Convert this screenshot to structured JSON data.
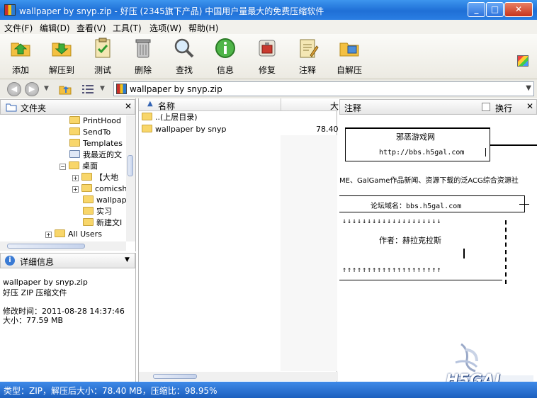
{
  "window": {
    "title": "wallpaper  by snyp.zip - 好压 (2345旗下产品) 中国用户量最大的免费压缩软件"
  },
  "menu": [
    "文件(F)",
    "编辑(D)",
    "查看(V)",
    "工具(T)",
    "选项(W)",
    "帮助(H)"
  ],
  "toolbar": [
    {
      "label": "添加",
      "icon": "add-icon"
    },
    {
      "label": "解压到",
      "icon": "extract-icon"
    },
    {
      "label": "测试",
      "icon": "test-icon"
    },
    {
      "label": "删除",
      "icon": "delete-icon"
    },
    {
      "label": "查找",
      "icon": "find-icon"
    },
    {
      "label": "信息",
      "icon": "info-icon"
    },
    {
      "label": "修复",
      "icon": "repair-icon"
    },
    {
      "label": "注释",
      "icon": "comment-icon"
    },
    {
      "label": "自解压",
      "icon": "sfx-icon"
    }
  ],
  "address": {
    "path": "wallpaper  by snyp.zip"
  },
  "folder_pane": {
    "title": "文件夹",
    "items": [
      "PrintHood",
      "SendTo",
      "Templates",
      "我最近的文",
      "桌面",
      "【大地",
      "comicshe",
      "wallpape",
      "实习",
      "新建文I",
      "All Users"
    ]
  },
  "details": {
    "title": "详细信息",
    "name": "wallpaper  by snyp.zip",
    "type": "好压 ZIP 压缩文件",
    "modified": "修改时间：2011-08-28 14:37:46",
    "size": "大小：77.59 MB"
  },
  "filelist": {
    "col_name": "名称",
    "col_size": "大",
    "rows": [
      {
        "name": "..(上层目录)",
        "size": ""
      },
      {
        "name": "wallpaper  by snyp",
        "size": "78.40"
      }
    ]
  },
  "comment_pane": {
    "title": "注释",
    "wrap_label": "换行",
    "site_name": "邪恶游戏网",
    "url": "http://bbs.h5gal.com",
    "desc": "ME、GalGame作品新闻、资源下载的泛ACG综合资源社",
    "domain": "论坛域名：bbs.h5gal.com",
    "arrows_down": "↓↓↓↓↓↓↓↓↓↓↓↓↓↓↓↓↓↓↓↓",
    "author": "作者：赫拉克拉斯",
    "arrows_up": "↑↑↑↑↑↑↑↑↑↑↑↑↑↑↑↑↑↑↑↑",
    "watermark": "H5GAL"
  },
  "status": {
    "text": "类型：ZIP，解压后大小：78.40 MB，压缩比：98.95%"
  }
}
